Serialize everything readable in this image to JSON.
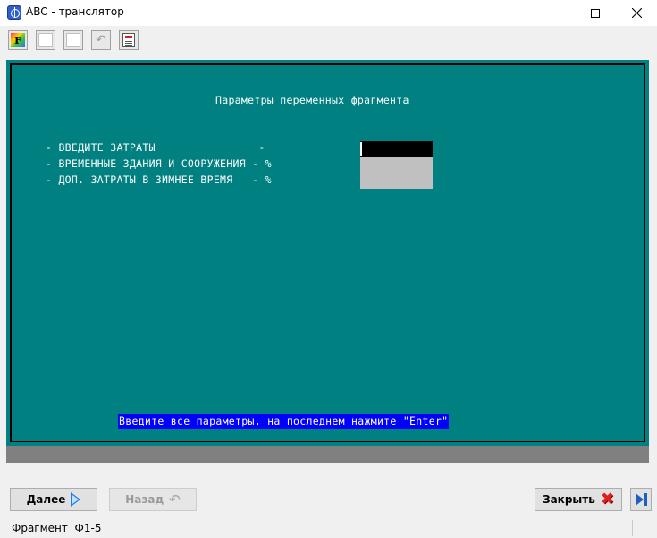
{
  "window": {
    "title": "ABC - транслятор"
  },
  "toolbar": {
    "buttons": [
      {
        "icon": "font-color-icon"
      },
      {
        "icon": "blank-icon"
      },
      {
        "icon": "blank-icon"
      },
      {
        "icon": "undo-icon"
      },
      {
        "icon": "document-icon"
      }
    ],
    "font_glyph": "F"
  },
  "console": {
    "title": "Параметры переменных фрагмента",
    "lines": [
      "- ВВЕДИТЕ ЗАТРАТЫ                -",
      "- ВРЕМЕННЫЕ ЗДАНИЯ И СООРУЖЕНИЯ - %",
      "- ДОП. ЗАТРАТЫ В ЗИМНЕЕ ВРЕМЯ   - %"
    ],
    "fields": [
      {
        "value": ""
      },
      {
        "value": ""
      },
      {
        "value": ""
      }
    ],
    "hint": "Введите все параметры, на последнем нажмите \"Enter\"",
    "colors": {
      "background": "#008080",
      "text": "#ffffff",
      "hint_background": "#0000ff",
      "active_field": "#000000",
      "inactive_field": "#c0c0c0"
    }
  },
  "buttons": {
    "next_label": "Далее",
    "back_label": "Назад",
    "close_label": "Закрыть"
  },
  "status": {
    "fragment_label": "Фрагмент",
    "fragment_value": "Ф1-5"
  }
}
